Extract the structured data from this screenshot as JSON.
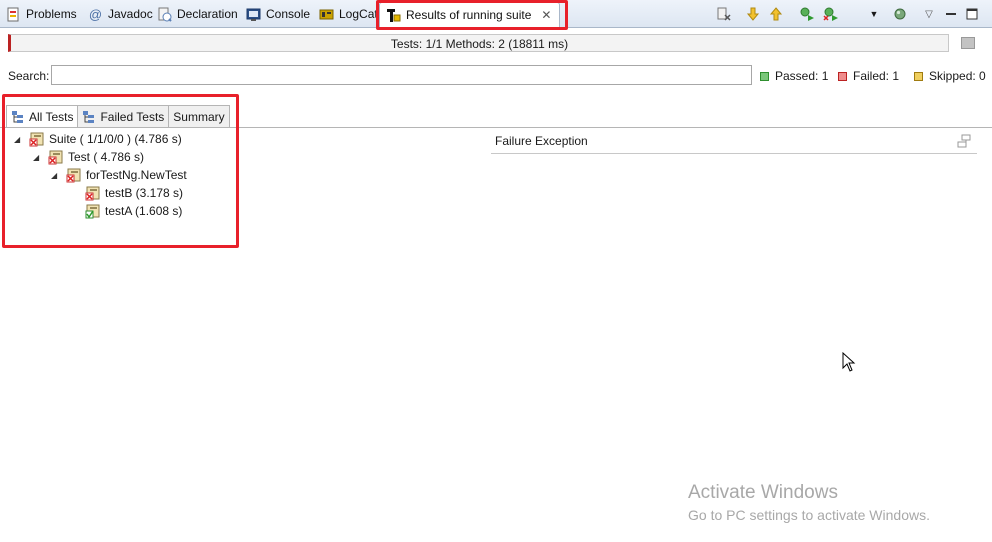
{
  "tabs": [
    {
      "label": "Problems",
      "icon": "problems-icon"
    },
    {
      "label": "Javadoc",
      "icon": "at-sign-icon",
      "glyph": "@"
    },
    {
      "label": "Declaration",
      "icon": "declaration-icon"
    },
    {
      "label": "Console",
      "icon": "console-icon"
    },
    {
      "label": "LogCat",
      "icon": "logcat-icon"
    },
    {
      "label": "Results of running suite",
      "icon": "testng-icon",
      "active": true
    }
  ],
  "progress": {
    "text": "Tests: 1/1  Methods: 2 (18811 ms)",
    "value": 1.0,
    "state_color": "#b22222"
  },
  "search": {
    "label": "Search:",
    "value": ""
  },
  "stats": {
    "passed": "Passed: 1",
    "failed": "Failed: 1",
    "skipped": "Skipped: 0"
  },
  "view_tabs": [
    {
      "label": "All Tests",
      "active": true
    },
    {
      "label": "Failed Tests"
    },
    {
      "label": "Summary"
    }
  ],
  "tree": [
    {
      "label": "Suite ( 1/1/0/0 ) (4.786 s)",
      "status": "failed",
      "expanded": true
    },
    {
      "label": "Test ( 4.786 s)",
      "status": "failed",
      "expanded": true
    },
    {
      "label": "forTestNg.NewTest",
      "status": "failed",
      "expanded": true
    },
    {
      "label": "testB  (3.178 s)",
      "status": "failed"
    },
    {
      "label": "testA  (1.608 s)",
      "status": "passed"
    }
  ],
  "failure": {
    "title": "Failure Exception"
  },
  "watermark": {
    "line1": "Activate Windows",
    "line2": "Go to PC settings to activate Windows."
  },
  "colors": {
    "highlight": "#e8202a",
    "passed": "#2f8f2f",
    "failed": "#d22d2d",
    "skipped": "#d9a32a"
  }
}
